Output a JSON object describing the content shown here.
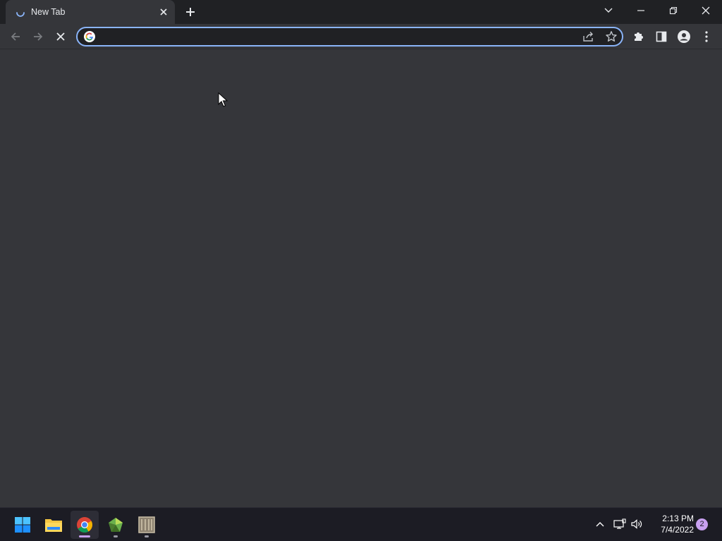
{
  "browser": {
    "tab": {
      "title": "New Tab",
      "icon": "loading-spinner"
    },
    "new_tab_icon": "plus-icon",
    "window_controls": [
      "tab-search-icon",
      "minimize-icon",
      "restore-icon",
      "close-icon"
    ],
    "toolbar": {
      "back_icon": "back-arrow-icon",
      "forward_icon": "forward-arrow-icon",
      "stop_icon": "stop-icon",
      "omnibox": {
        "value": "",
        "placeholder": "",
        "leading_icon": "google-icon",
        "trailing_icons": [
          "share-icon",
          "bookmark-star-icon"
        ]
      },
      "right_icons": [
        "extensions-icon",
        "side-panel-icon",
        "profile-icon",
        "menu-icon"
      ]
    }
  },
  "taskbar": {
    "apps": [
      "windows-start-icon",
      "file-explorer-icon",
      "chrome-icon",
      "green-gem-app-icon",
      "image-app-icon"
    ],
    "tray_icons": [
      "chevron-up-icon",
      "network-icon",
      "volume-icon"
    ],
    "time": "2:13 PM",
    "date": "7/4/2022",
    "notification_count": "2"
  },
  "colors": {
    "frame": "#202124",
    "toolbar": "#35363a",
    "accent": "#8ab4f8",
    "taskbar": "#1c1c24",
    "chrome_indicator": "#c8a0f0"
  }
}
